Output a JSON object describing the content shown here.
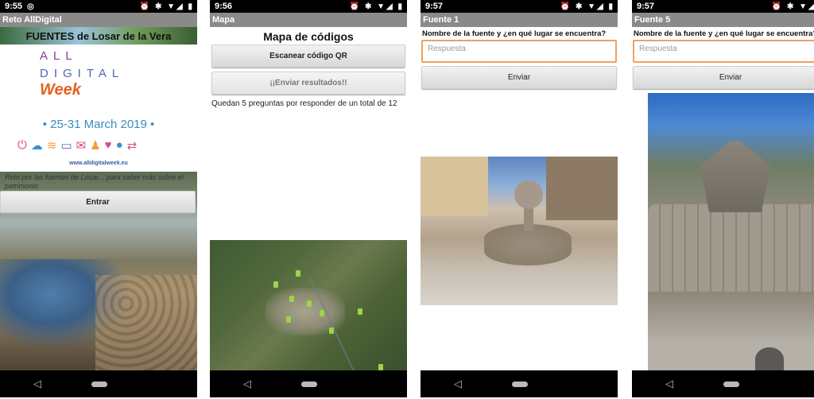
{
  "screens": [
    {
      "status": {
        "time": "9:55",
        "left_icons": "◎"
      },
      "title": "Reto AllDigital",
      "banner": "FUENTES de Losar de la Vera",
      "poster": {
        "line1": "ALL",
        "line2": "DIGITAL",
        "line3": "Week",
        "dates": "• 25-31 March 2019 •",
        "url": "www.alldigitalweek.eu"
      },
      "overlay_text": "Reto por las fuentes de Losar... para saber más sobre el patrimonio",
      "button": "Entrar"
    },
    {
      "status": {
        "time": "9:56",
        "left_icons": ""
      },
      "title": "Mapa",
      "heading": "Mapa de códigos",
      "scan_button": "Escanear código QR",
      "send_button": "¡¡Enviar resultados!!",
      "remaining_text": "Quedan 5 preguntas por responder de un total de 12"
    },
    {
      "status": {
        "time": "9:57",
        "left_icons": ""
      },
      "title": "Fuente 1",
      "question": "Nombre de la fuente y ¿en qué lugar se encuentra?",
      "answer_placeholder": "Respuesta",
      "send_button": "Enviar"
    },
    {
      "status": {
        "time": "9:57",
        "left_icons": ""
      },
      "title": "Fuente 5",
      "question": "Nombre de la fuente y ¿en qué lugar se encuentra?",
      "answer_placeholder": "Respuesta",
      "send_button": "Enviar"
    }
  ],
  "status_right_icons": "⏰ ✱ ▼◢ ▮",
  "icons": {
    "back": "back-icon",
    "home": "home-icon",
    "alarm": "alarm-icon",
    "bluetooth": "bluetooth-icon",
    "wifi": "wifi-icon",
    "signal": "signal-icon",
    "battery": "battery-icon"
  },
  "colors": {
    "titlebar": "#8a8a8a",
    "input_focus": "#f0a060",
    "statusbar": "#000000"
  }
}
